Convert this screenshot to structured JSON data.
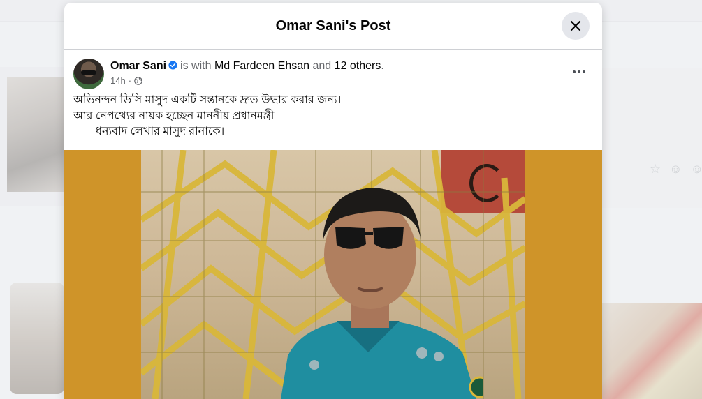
{
  "modal": {
    "title": "Omar Sani's Post"
  },
  "post": {
    "author": "Omar Sani",
    "with_text": "is with",
    "tagged_person": "Md Fardeen Ehsan",
    "and_text": "and",
    "others": "12 others",
    "period": ".",
    "time": "14h",
    "separator": "·",
    "lines": [
      "অভিনন্দন ডিসি মাসুদ একটি সন্তানকে দ্রুত উদ্ধার করার জন্য।",
      "আর নেপথ্যের নায়ক হচ্ছেন মাননীয় প্রধানমন্ত্রী",
      "ধন্যবাদ লেখার মাসুদ রানাকে।"
    ]
  },
  "icons": {
    "close": "close-icon",
    "verified": "verified-badge-icon",
    "privacy": "globe-icon",
    "more": "more-options-icon"
  },
  "colors": {
    "accent": "#1877f2",
    "media_background": "#cf9429",
    "uniform": "#1f8ea0"
  }
}
